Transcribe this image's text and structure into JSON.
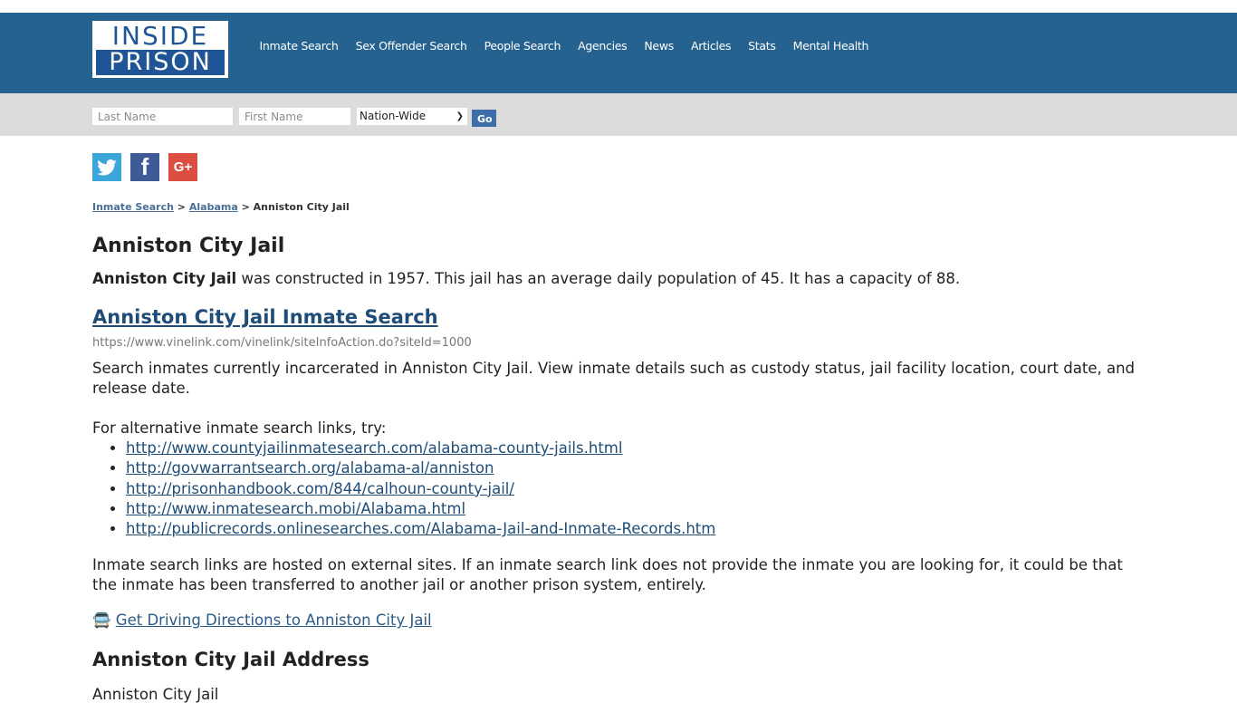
{
  "logo": {
    "line1": "INSIDE",
    "line2": "PRISON"
  },
  "nav": [
    {
      "label": "Inmate Search"
    },
    {
      "label": "Sex Offender Search"
    },
    {
      "label": "People Search"
    },
    {
      "label": "Agencies"
    },
    {
      "label": "News"
    },
    {
      "label": "Articles"
    },
    {
      "label": "Stats"
    },
    {
      "label": "Mental Health"
    }
  ],
  "search": {
    "last_name_placeholder": "Last Name",
    "first_name_placeholder": "First Name",
    "region_selected": "Nation-Wide",
    "go_label": "Go"
  },
  "social": {
    "twitter": "twitter-icon",
    "facebook": "facebook-icon",
    "google_plus": "google-plus-icon"
  },
  "breadcrumb": {
    "item1": "Inmate Search",
    "sep": ">",
    "item2": "Alabama",
    "current": "Anniston City Jail"
  },
  "title": "Anniston City Jail",
  "intro": {
    "bold": "Anniston City Jail",
    "rest": " was constructed in 1957. This jail has an average daily population of 45. It has a capacity of 88."
  },
  "inmate_search": {
    "heading": "Anniston City Jail Inmate Search",
    "url": "https://www.vinelink.com/vinelink/siteInfoAction.do?siteId=1000",
    "description": "Search inmates currently incarcerated in Anniston City Jail. View inmate details such as custody status, jail facility location, court date, and release date.",
    "alt_intro": "For alternative inmate search links, try:",
    "alt_links": [
      "http://www.countyjailinmatesearch.com/alabama-county-jails.html",
      "http://govwarrantsearch.org/alabama-al/anniston",
      "http://prisonhandbook.com/844/calhoun-county-jail/",
      "http://www.inmatesearch.mobi/Alabama.html",
      "http://publicrecords.onlinesearches.com/Alabama-Jail-and-Inmate-Records.htm"
    ],
    "disclaimer": "Inmate search links are hosted on external sites. If an inmate search link does not provide the inmate you are looking for, it could be that the inmate has been transferred to another jail or another prison system, entirely."
  },
  "directions": {
    "icon": "bus-icon",
    "label": "Get Driving Directions to Anniston City Jail"
  },
  "address": {
    "heading": "Anniston City Jail Address",
    "line1": "Anniston City Jail"
  }
}
